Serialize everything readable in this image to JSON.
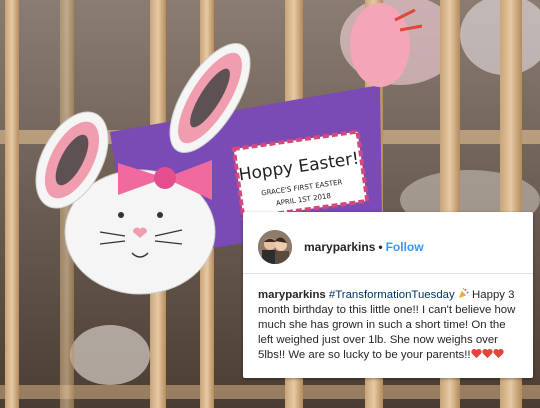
{
  "post": {
    "username": "maryparkins",
    "separator": "•",
    "follow_label": "Follow",
    "caption_username": "maryparkins",
    "caption_hashtag": "#TransformationTuesday",
    "caption_text": "Happy 3 month birthday to this little one!! I can't believe how much she has grown in such a short time! On the left weighed just over 1lb. She now weighs over 5lbs!! We are so lucky to be your parents!!"
  },
  "easter_card": {
    "title": "Hoppy Easter!",
    "subtitle": "GRACE'S FIRST EASTER",
    "date": "APRIL 1ST 2018"
  },
  "icons": {
    "party": "party-popper-icon",
    "hearts": [
      "red-heart-icon",
      "red-heart-icon",
      "red-heart-icon"
    ]
  },
  "colors": {
    "follow": "#3897f0",
    "hashtag": "#003569",
    "heart": "#e0463c",
    "purple_paper": "#7a4bb5",
    "bunny_pink": "#f19db0"
  }
}
